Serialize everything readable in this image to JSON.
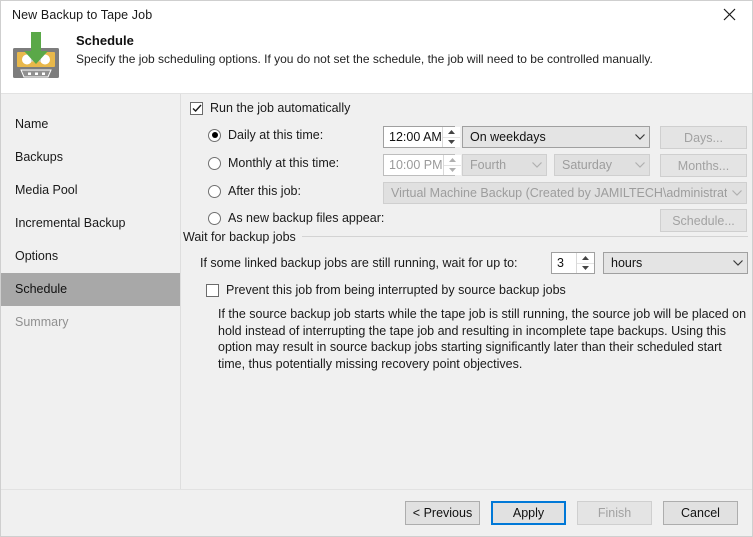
{
  "window": {
    "title": "New Backup to Tape Job",
    "close_label": "✕"
  },
  "header": {
    "title": "Schedule",
    "subtitle": "Specify the job scheduling options. If you do not set the schedule, the job will need to be controlled manually.",
    "icon": "tape-backup-icon"
  },
  "sidebar": {
    "items": [
      {
        "label": "Name",
        "state": "normal"
      },
      {
        "label": "Backups",
        "state": "normal"
      },
      {
        "label": "Media Pool",
        "state": "normal"
      },
      {
        "label": "Incremental Backup",
        "state": "normal"
      },
      {
        "label": "Options",
        "state": "normal"
      },
      {
        "label": "Schedule",
        "state": "selected"
      },
      {
        "label": "Summary",
        "state": "disabled"
      }
    ]
  },
  "main": {
    "run_auto": {
      "label": "Run the job automatically",
      "checked": true
    },
    "options": [
      {
        "key": "daily",
        "label": "Daily at this time:",
        "selected": true,
        "time": "12:00 AM",
        "combo": "On weekdays",
        "button": "Days..."
      },
      {
        "key": "monthly",
        "label": "Monthly at this time:",
        "selected": false,
        "time": "10:00 PM",
        "combo_week": "Fourth",
        "combo_day": "Saturday",
        "button": "Months..."
      },
      {
        "key": "after_job",
        "label": "After this job:",
        "selected": false,
        "combo": "Virtual Machine Backup (Created by JAMILTECH\\administrator"
      },
      {
        "key": "new_files",
        "label": "As new backup files appear:",
        "selected": false,
        "button": "Schedule..."
      }
    ],
    "wait_group": {
      "title": "Wait for backup jobs",
      "wait_label": "If some linked backup jobs are still running, wait for up to:",
      "wait_value": "3",
      "wait_unit": "hours",
      "prevent_label": "Prevent this job from being interrupted by source backup jobs",
      "prevent_checked": false,
      "description": "If the source backup job starts while the tape job is still running, the source job will be placed on hold instead of interrupting the tape job and resulting in incomplete tape backups. Using this option may result in source backup jobs starting significantly later than their scheduled start time, thus potentially missing recovery point objectives."
    }
  },
  "footer": {
    "previous": "< Previous",
    "apply": "Apply",
    "finish": "Finish",
    "cancel": "Cancel"
  },
  "colors": {
    "accent": "#0078d7",
    "selection": "#a8a8a8",
    "surface": "#f0f0f0",
    "icon_green": "#5aa848",
    "icon_tape": "#e8b84b"
  }
}
